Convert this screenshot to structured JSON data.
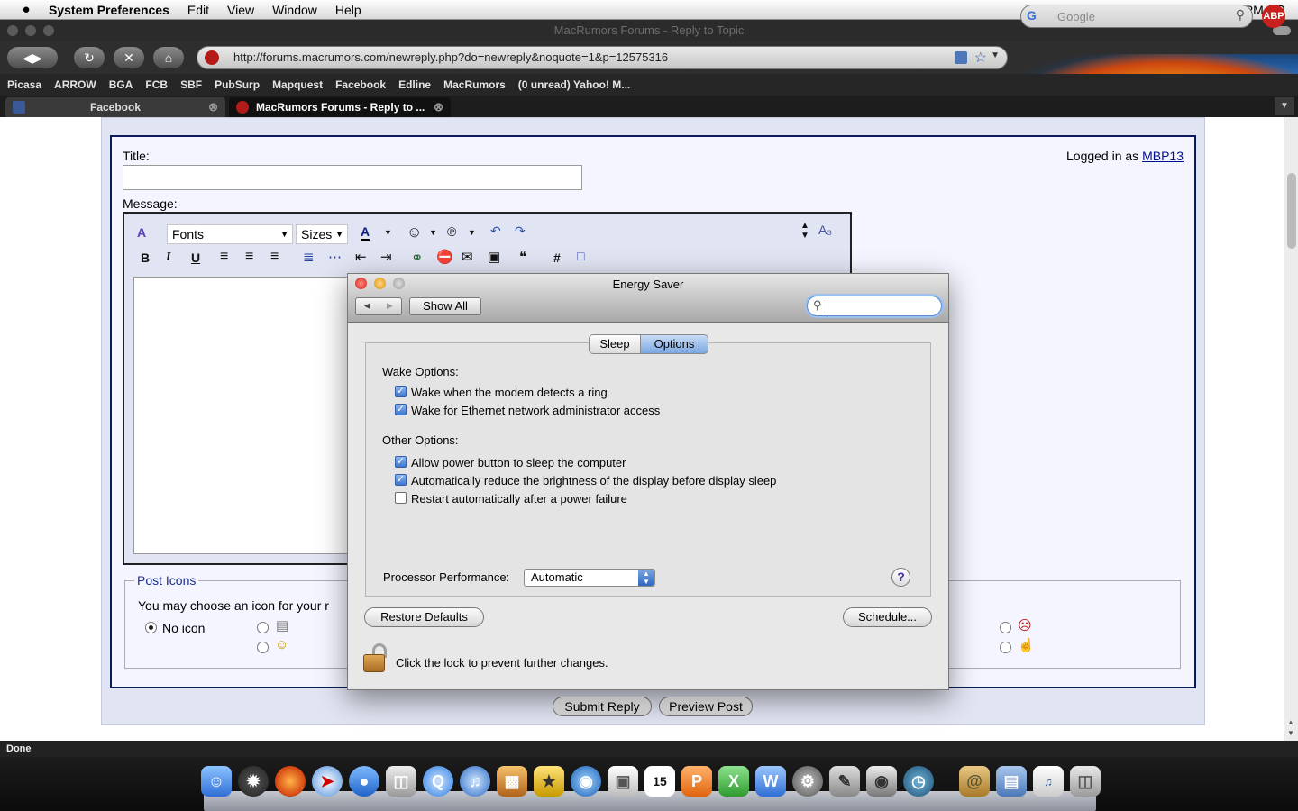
{
  "menubar": {
    "apple": "",
    "app_name": "System Preferences",
    "menus": [
      "Edit",
      "View",
      "Window",
      "Help"
    ],
    "clock": "Sun 9:35 PM"
  },
  "browser": {
    "window_title": "MacRumors Forums - Reply to Topic",
    "url": "http://forums.macrumors.com/newreply.php?do=newreply&noquote=1&p=12575316",
    "search_placeholder": "Google",
    "abp_label": "ABP",
    "bookmarks": [
      "Picasa",
      "ARROW",
      "BGA",
      "FCB",
      "SBF",
      "PubSurp",
      "Mapquest",
      "Facebook",
      "Edline",
      "MacRumors",
      "(0 unread) Yahoo! M..."
    ],
    "tabs": [
      {
        "label": "Facebook",
        "active": false
      },
      {
        "label": "MacRumors Forums - Reply to ...",
        "active": true
      }
    ],
    "status": "Done"
  },
  "form": {
    "title_label": "Title:",
    "message_label": "Message:",
    "logged_in_prefix": "Logged in as",
    "username": "MBP13",
    "fonts_label": "Fonts",
    "sizes_label": "Sizes",
    "post_icons_legend": "Post Icons",
    "post_icons_text": "You may choose an icon for your r",
    "no_icon_label": "No icon",
    "submit_label": "Submit Reply",
    "preview_label": "Preview Post"
  },
  "energy_saver": {
    "title": "Energy Saver",
    "show_all": "Show All",
    "tabs": [
      "Sleep",
      "Options"
    ],
    "active_tab": "Options",
    "wake_heading": "Wake Options:",
    "wake_options": [
      {
        "label": "Wake when the modem detects a ring",
        "checked": true
      },
      {
        "label": "Wake for Ethernet network administrator access",
        "checked": true
      }
    ],
    "other_heading": "Other Options:",
    "other_options": [
      {
        "label": "Allow power button to sleep the computer",
        "checked": true
      },
      {
        "label": "Automatically reduce the brightness of the display before display sleep",
        "checked": true
      },
      {
        "label": "Restart automatically after a power failure",
        "checked": false
      }
    ],
    "processor_label": "Processor Performance:",
    "processor_value": "Automatic",
    "restore_defaults": "Restore Defaults",
    "schedule": "Schedule...",
    "lock_text": "Click the lock to prevent further changes."
  },
  "colors": {
    "link": "#000e8f",
    "panel_border": "#0b1a5b",
    "accent_blue": "#3d77cf"
  }
}
